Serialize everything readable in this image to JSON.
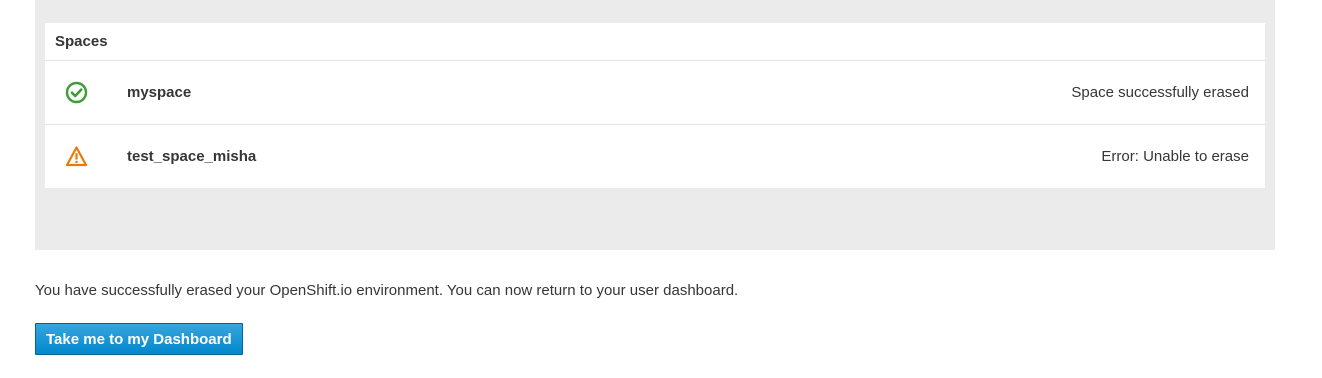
{
  "spaces": {
    "header": "Spaces",
    "items": [
      {
        "name": "myspace",
        "status": "Space successfully erased",
        "icon": "success-check-circle-icon",
        "icon_color": "#3f9c35"
      },
      {
        "name": "test_space_misha",
        "status": "Error: Unable to erase",
        "icon": "warning-triangle-icon",
        "icon_color": "#ec7a08"
      }
    ]
  },
  "message": "You have successfully erased your OpenShift.io environment. You can now return to your user dashboard.",
  "dashboard_button": {
    "label": "Take me to my Dashboard",
    "color": "#0088ce"
  }
}
